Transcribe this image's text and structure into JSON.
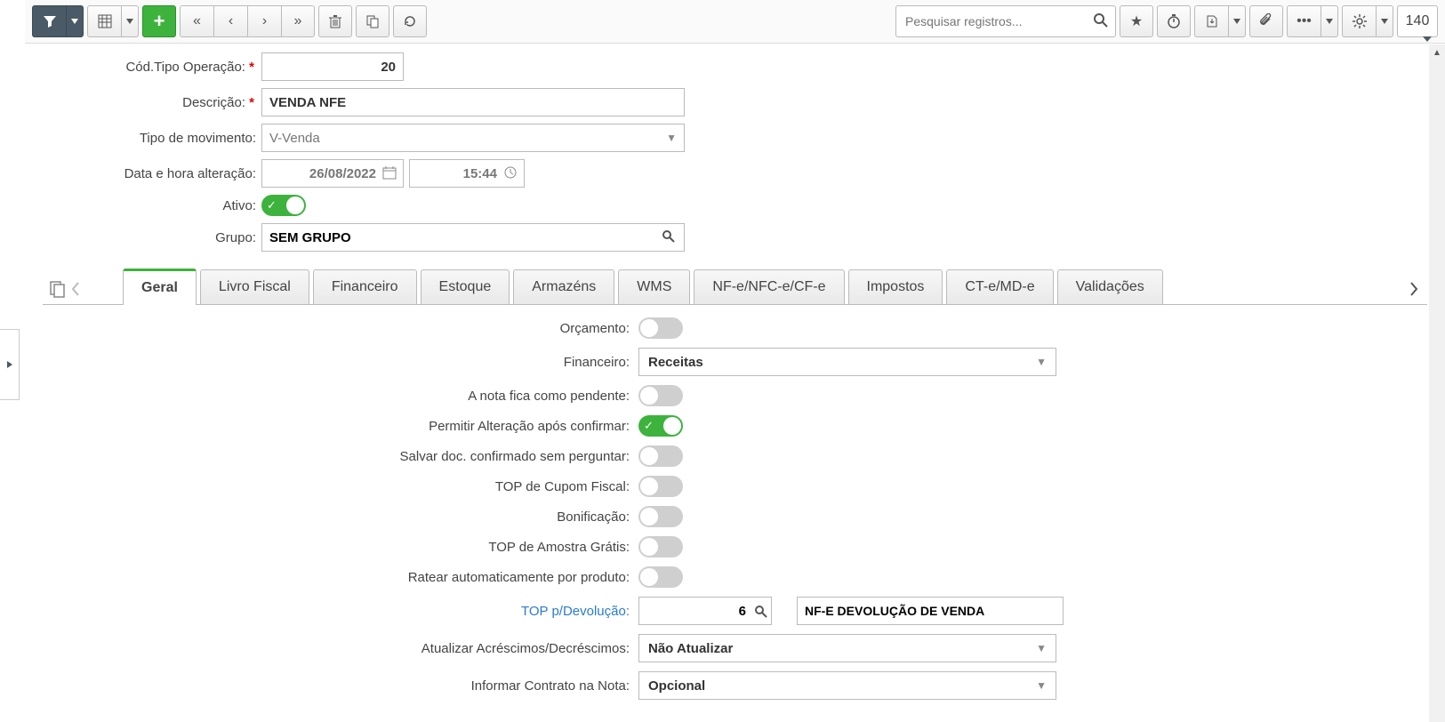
{
  "toolbar": {
    "search_placeholder": "Pesquisar registros...",
    "record_count": "140"
  },
  "form": {
    "labels": {
      "codigo": "Cód.Tipo Operação:",
      "descricao": "Descrição:",
      "tipo_movimento": "Tipo de movimento:",
      "data_alteracao": "Data e hora alteração:",
      "ativo": "Ativo:",
      "grupo": "Grupo:"
    },
    "codigo": "20",
    "descricao": "VENDA NFE",
    "tipo_movimento": "V-Venda",
    "data": "26/08/2022",
    "hora": "15:44",
    "ativo": true,
    "grupo": "SEM GRUPO"
  },
  "tabs": [
    "Geral",
    "Livro Fiscal",
    "Financeiro",
    "Estoque",
    "Armazéns",
    "WMS",
    "NF-e/NFC-e/CF-e",
    "Impostos",
    "CT-e/MD-e",
    "Validações"
  ],
  "geral": {
    "labels": {
      "orcamento": "Orçamento:",
      "financeiro": "Financeiro:",
      "nota_pendente": "A nota fica como pendente:",
      "permitir_alteracao": "Permitir Alteração após confirmar:",
      "salvar_sem_perguntar": "Salvar doc. confirmado sem perguntar:",
      "top_cupom": "TOP de Cupom Fiscal:",
      "bonificacao": "Bonificação:",
      "top_amostra": "TOP de Amostra Grátis:",
      "ratear": "Ratear automaticamente por produto:",
      "top_devolucao": "TOP p/Devolução:",
      "atualizar_acrescimos": "Atualizar Acréscimos/Decréscimos:",
      "informar_contrato": "Informar Contrato na Nota:"
    },
    "financeiro": "Receitas",
    "top_devolucao_num": "6",
    "top_devolucao_desc": "NF-E DEVOLUÇÃO DE VENDA",
    "atualizar_acrescimos": "Não Atualizar",
    "informar_contrato": "Opcional",
    "toggles": {
      "orcamento": false,
      "nota_pendente": false,
      "permitir_alteracao": true,
      "salvar_sem_perguntar": false,
      "top_cupom": false,
      "bonificacao": false,
      "top_amostra": false,
      "ratear": false
    }
  }
}
